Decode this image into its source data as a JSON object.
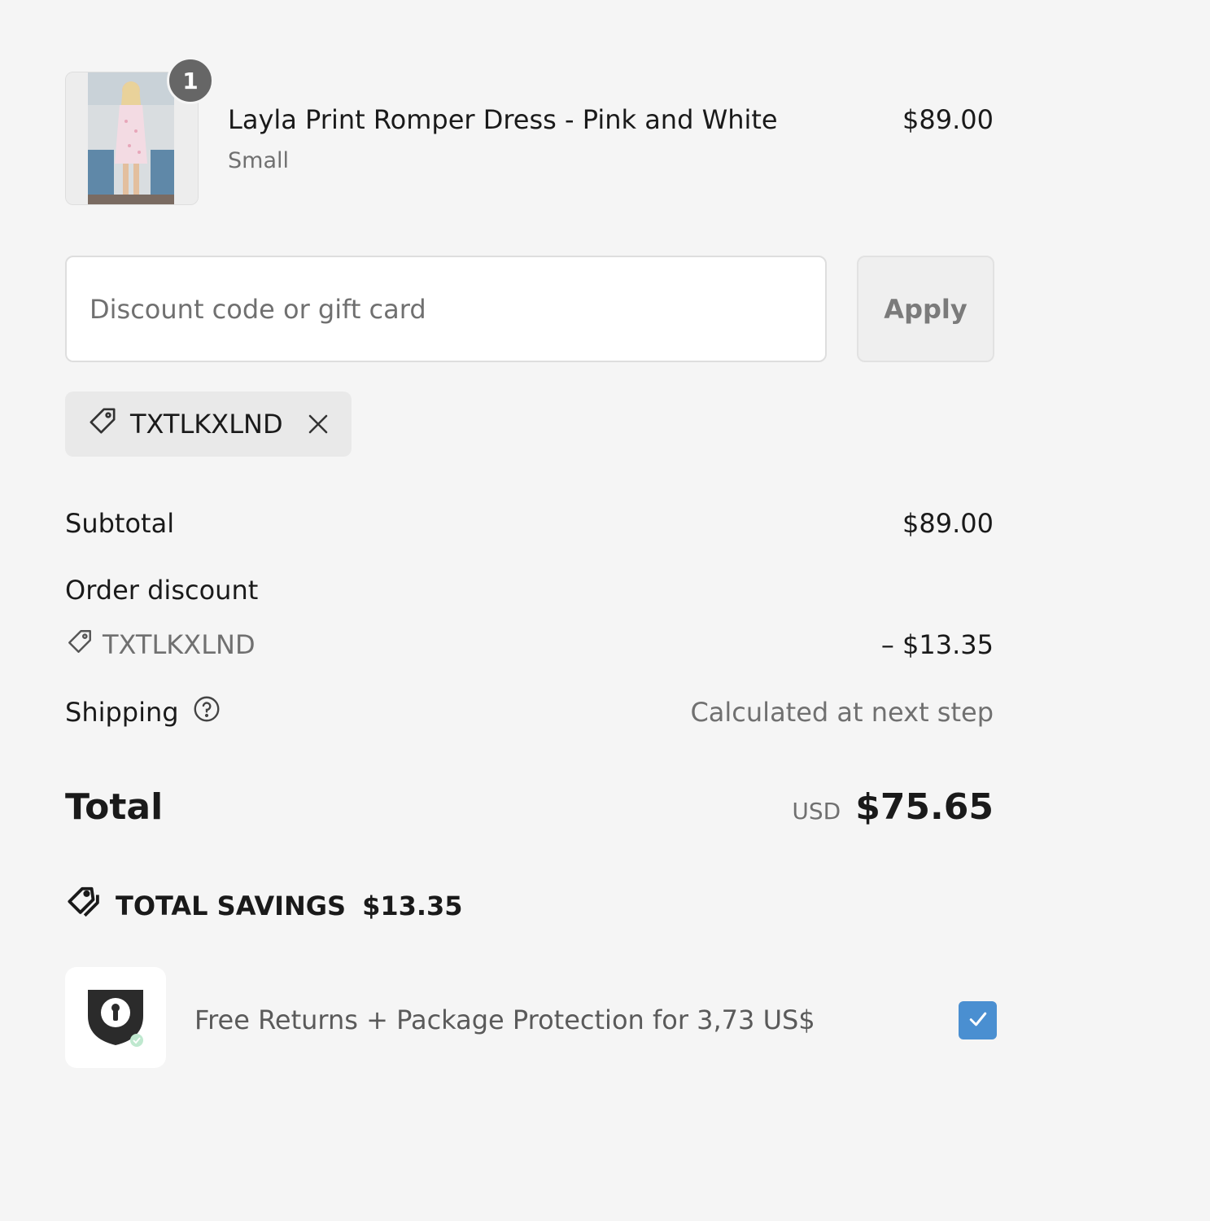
{
  "line_item": {
    "quantity": "1",
    "title": "Layla Print Romper Dress - Pink and White",
    "variant": "Small",
    "price": "$89.00"
  },
  "discount": {
    "placeholder": "Discount code or gift card",
    "value": "",
    "apply_label": "Apply",
    "applied_code": "TXTLKXLND"
  },
  "summary": {
    "subtotal_label": "Subtotal",
    "subtotal_value": "$89.00",
    "order_discount_label": "Order discount",
    "order_discount_code": "TXTLKXLND",
    "order_discount_value": "– $13.35",
    "shipping_label": "Shipping",
    "shipping_value": "Calculated at next step",
    "total_label": "Total",
    "currency": "USD",
    "total_value": "$75.65",
    "savings_label": "TOTAL SAVINGS",
    "savings_value": "$13.35"
  },
  "protection": {
    "text": "Free Returns + Package Protection for 3,73 US$",
    "checked": true
  },
  "icons": {
    "tag": "tag-icon",
    "remove": "close-icon",
    "help": "question-circle-icon",
    "savings": "double-tag-icon",
    "shield": "shield-lock-icon",
    "check": "check-icon"
  },
  "colors": {
    "background": "#f5f5f5",
    "checkbox": "#4a8fd1",
    "badge": "#666666",
    "muted_text": "#707070"
  }
}
